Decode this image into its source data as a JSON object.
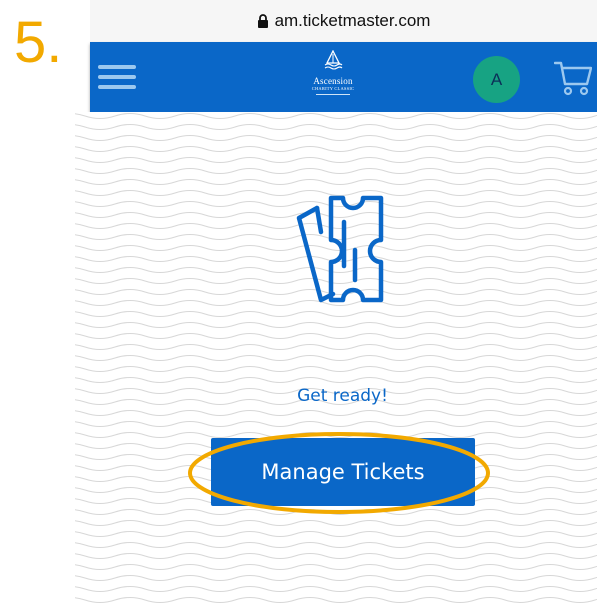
{
  "step": {
    "number": "5."
  },
  "browser": {
    "url": "am.ticketmaster.com",
    "lock_icon": "lock-icon"
  },
  "header": {
    "menu_icon": "hamburger-menu-icon",
    "logo": {
      "name": "Ascension",
      "subtitle": "CHARITY CLASSIC"
    },
    "avatar_initial": "A",
    "cart_icon": "shopping-cart-icon"
  },
  "main": {
    "illustration_icon": "tickets-icon",
    "message": "Get ready!",
    "manage_button_label": "Manage Tickets"
  },
  "colors": {
    "brand_blue": "#0a67c8",
    "avatar_green": "#17a383",
    "highlight_orange": "#f2a900",
    "wave_lines": "#d7d7d7"
  }
}
